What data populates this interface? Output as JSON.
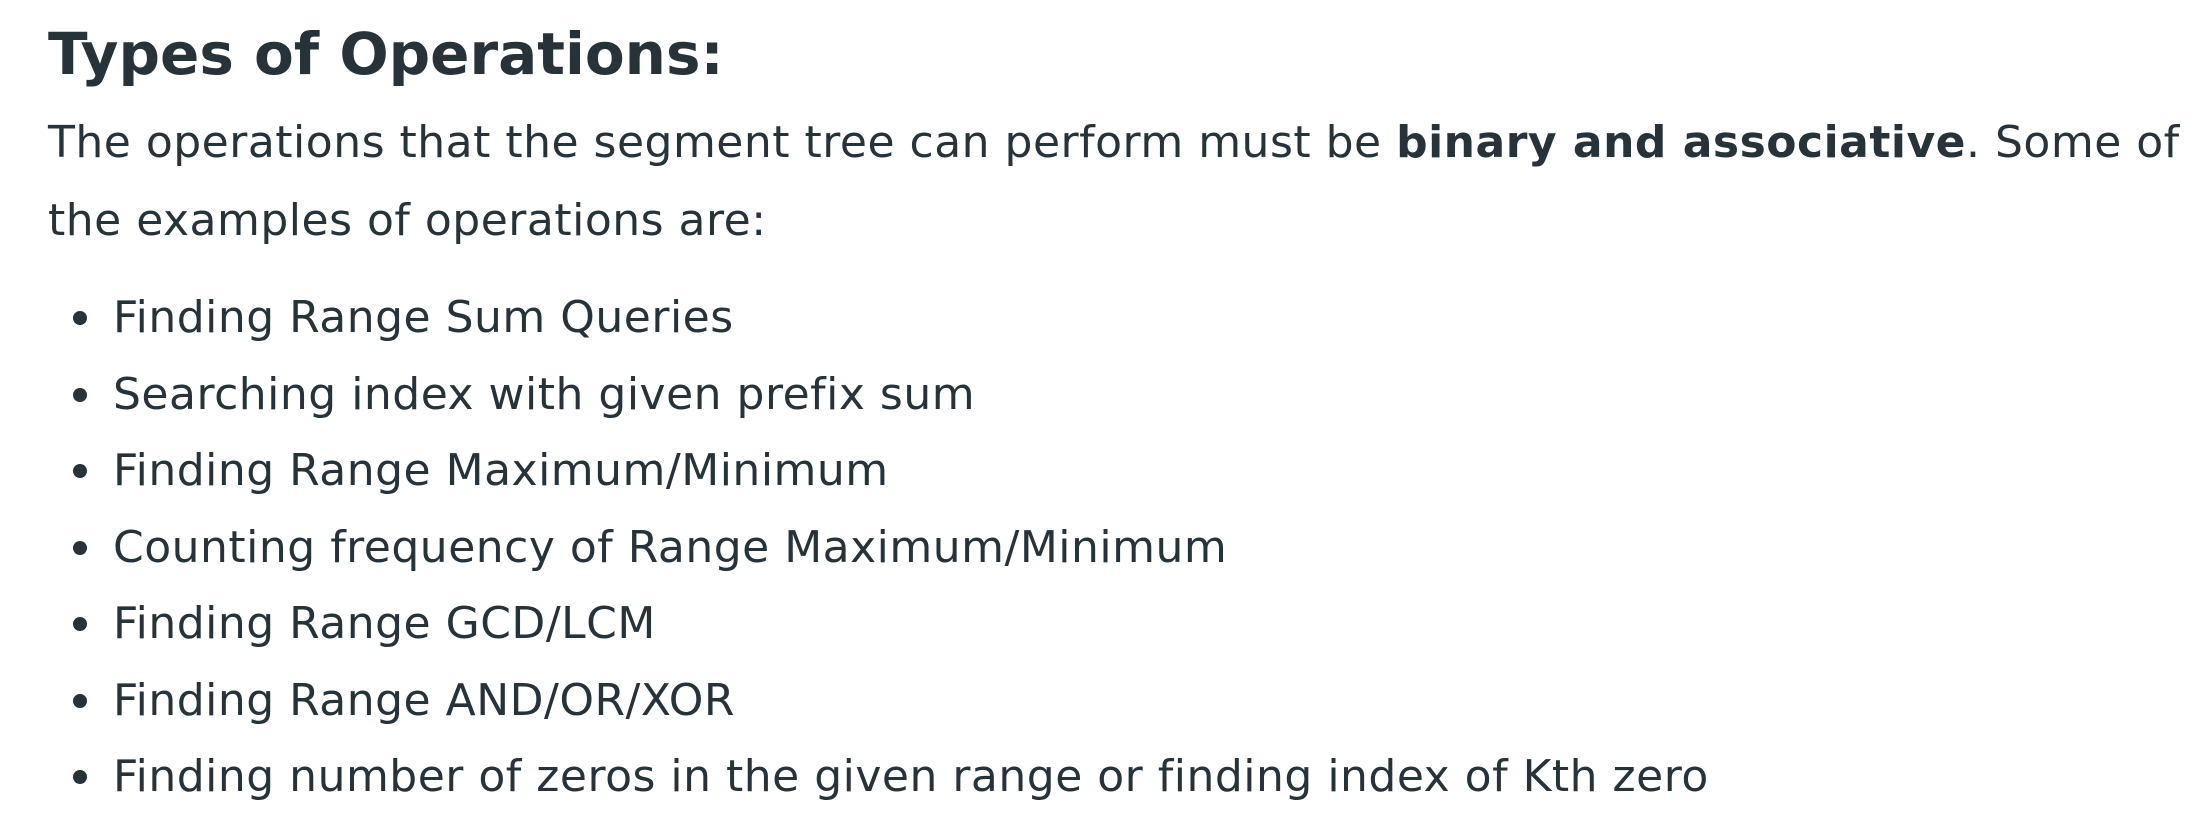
{
  "section": {
    "heading": "Types of Operations:",
    "intro_before": "The operations that the segment tree can perform must be ",
    "intro_bold": "binary and associative",
    "intro_after": ". Some of the examples of operations are:"
  },
  "operations": [
    "Finding Range Sum Queries",
    "Searching index with given prefix sum",
    "Finding Range Maximum/Minimum",
    "Counting frequency of Range Maximum/Minimum",
    "Finding Range GCD/LCM",
    "Finding Range AND/OR/XOR",
    "Finding number of zeros in the given range or finding index of Kth zero"
  ]
}
